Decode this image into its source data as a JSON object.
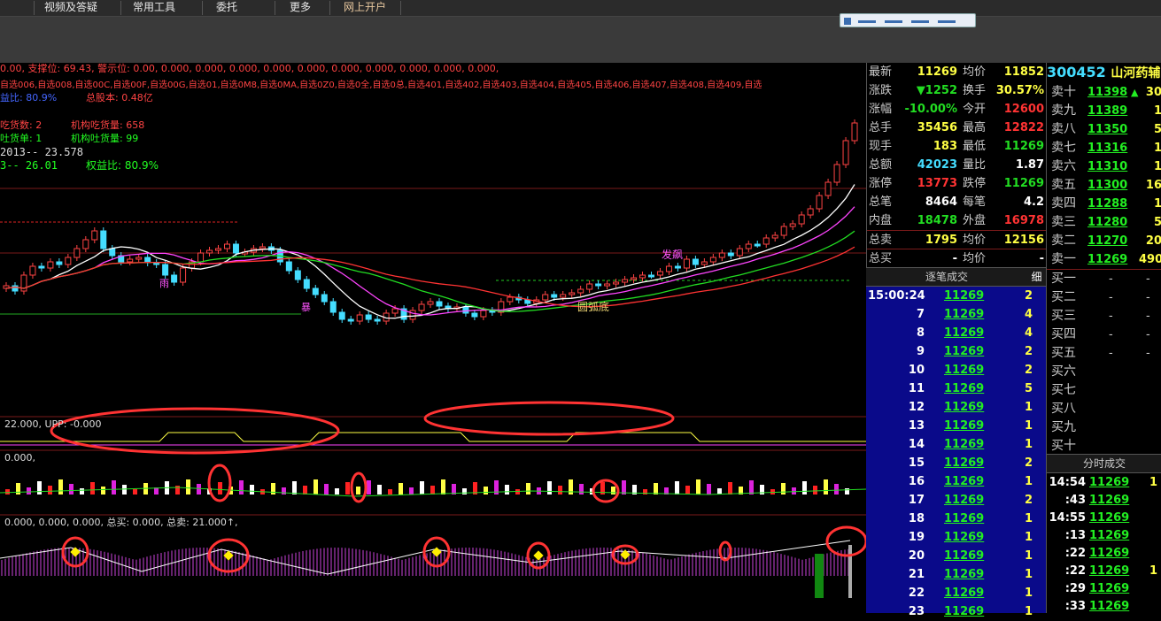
{
  "menu": {
    "items": [
      "视频及答疑",
      "常用工具",
      "委托",
      "更多",
      "网上开户"
    ]
  },
  "main_chart": {
    "indicator_line": "0.00, 支撑位: 69.43, 警示位: 0.00, 0.000, 0.000, 0.000, 0.000, 0.000, 0.000, 0.000, 0.000, 0.000, 0.000,",
    "watchlists": "自选006,自选008,自选00C,自选00F,自选00G,自选01,自选0M8,自选0MA,自选0Z0,自选0全,自选0总,自选401,自选402,自选403,自选404,自选405,自选406,自选407,自选408,自选409,自选",
    "info1": "益比: 80.9%",
    "info2": "总股本: 0.48亿",
    "info3": "吃货数: 2",
    "info4": "机构吃货量: 658",
    "info5": "吐货单: 1",
    "info6": "机构吐货量: 99",
    "info7": "2013-- 23.578",
    "info8": "3-- 26.01",
    "info9": "权益比: 80.9%",
    "label_fa": "发飙",
    "label_arc": "圆弧底",
    "label_rain": "雨",
    "label_bao": "暴"
  },
  "sub1": {
    "label": "22.000, UPP: -0.000"
  },
  "sub2": {
    "label": "0.000,"
  },
  "sub3": {
    "label": "0.000, 0.000, 0.000, 总买: 0.000, 总卖: 21.000↑,"
  },
  "quote": {
    "rows": [
      {
        "l1": "最新",
        "v1": "11269",
        "c1": "#ffff44",
        "l2": "均价",
        "v2": "11852",
        "c2": "#ffff44"
      },
      {
        "l1": "涨跌",
        "v1": "▼1252",
        "c1": "#22dd22",
        "l2": "换手",
        "v2": "30.57%",
        "c2": "#ffff44"
      },
      {
        "l1": "涨幅",
        "v1": "-10.00%",
        "c1": "#22dd22",
        "l2": "今开",
        "v2": "12600",
        "c2": "#ff3333"
      },
      {
        "l1": "总手",
        "v1": "35456",
        "c1": "#ffff44",
        "l2": "最高",
        "v2": "12822",
        "c2": "#ff3333"
      },
      {
        "l1": "现手",
        "v1": "183",
        "c1": "#ffff44",
        "l2": "最低",
        "v2": "11269",
        "c2": "#22dd22"
      },
      {
        "l1": "总额",
        "v1": "42023",
        "c1": "#44ddff",
        "l2": "量比",
        "v2": "1.87",
        "c2": "#ffffff"
      },
      {
        "l1": "涨停",
        "v1": "13773",
        "c1": "#ff3333",
        "l2": "跌停",
        "v2": "11269",
        "c2": "#22dd22"
      },
      {
        "l1": "总笔",
        "v1": "8464",
        "c1": "#ffffff",
        "l2": "每笔",
        "v2": "4.2",
        "c2": "#ffffff"
      },
      {
        "l1": "内盘",
        "v1": "18478",
        "c1": "#22dd22",
        "l2": "外盘",
        "v2": "16978",
        "c2": "#ff3333"
      },
      {
        "l1": "总卖",
        "v1": "1795",
        "c1": "#ffff44",
        "l2": "均价",
        "v2": "12156",
        "c2": "#ffff44"
      },
      {
        "l1": "总买",
        "v1": "-",
        "c1": "#ffffff",
        "l2": "均价",
        "v2": "-",
        "c2": "#ffffff"
      }
    ],
    "tick_header": "逐笔成交",
    "tick_tab": "细",
    "ticks": [
      {
        "t": "15:00:24",
        "p": "11269",
        "v": "2"
      },
      {
        "t": "7",
        "p": "11269",
        "v": "4"
      },
      {
        "t": "8",
        "p": "11269",
        "v": "4"
      },
      {
        "t": "9",
        "p": "11269",
        "v": "2"
      },
      {
        "t": "10",
        "p": "11269",
        "v": "2"
      },
      {
        "t": "11",
        "p": "11269",
        "v": "5"
      },
      {
        "t": "12",
        "p": "11269",
        "v": "1"
      },
      {
        "t": "13",
        "p": "11269",
        "v": "1"
      },
      {
        "t": "14",
        "p": "11269",
        "v": "1"
      },
      {
        "t": "15",
        "p": "11269",
        "v": "2"
      },
      {
        "t": "16",
        "p": "11269",
        "v": "1"
      },
      {
        "t": "17",
        "p": "11269",
        "v": "2"
      },
      {
        "t": "18",
        "p": "11269",
        "v": "1"
      },
      {
        "t": "19",
        "p": "11269",
        "v": "1"
      },
      {
        "t": "20",
        "p": "11269",
        "v": "1"
      },
      {
        "t": "21",
        "p": "11269",
        "v": "1"
      },
      {
        "t": "22",
        "p": "11269",
        "v": "1"
      },
      {
        "t": "23",
        "p": "11269",
        "v": "1"
      }
    ]
  },
  "orderbook": {
    "code": "300452",
    "name": "山河药辅",
    "asks": [
      {
        "l": "卖十",
        "p": "11398",
        "v": "30",
        "arrow": "▲"
      },
      {
        "l": "卖九",
        "p": "11389",
        "v": "1",
        "arrow": ""
      },
      {
        "l": "卖八",
        "p": "11350",
        "v": "5",
        "arrow": ""
      },
      {
        "l": "卖七",
        "p": "11316",
        "v": "1",
        "arrow": ""
      },
      {
        "l": "卖六",
        "p": "11310",
        "v": "1",
        "arrow": ""
      },
      {
        "l": "卖五",
        "p": "11300",
        "v": "16",
        "arrow": ""
      },
      {
        "l": "卖四",
        "p": "11288",
        "v": "1",
        "arrow": ""
      },
      {
        "l": "卖三",
        "p": "11280",
        "v": "5",
        "arrow": ""
      },
      {
        "l": "卖二",
        "p": "11270",
        "v": "20",
        "arrow": ""
      },
      {
        "l": "卖一",
        "p": "11269",
        "v": "490",
        "arrow": ""
      }
    ],
    "bids": [
      {
        "l": "买一",
        "p": "-",
        "v": "-"
      },
      {
        "l": "买二",
        "p": "-",
        "v": "-"
      },
      {
        "l": "买三",
        "p": "-",
        "v": "-"
      },
      {
        "l": "买四",
        "p": "-",
        "v": "-"
      },
      {
        "l": "买五",
        "p": "-",
        "v": "-"
      },
      {
        "l": "买六",
        "p": "",
        "v": ""
      },
      {
        "l": "买七",
        "p": "",
        "v": ""
      },
      {
        "l": "买八",
        "p": "",
        "v": ""
      },
      {
        "l": "买九",
        "p": "",
        "v": ""
      },
      {
        "l": "买十",
        "p": "",
        "v": ""
      }
    ],
    "time_header": "分时成交",
    "time_ticks": [
      {
        "t": "14:54",
        "p": "11269",
        "v": "1"
      },
      {
        "t": ":43",
        "p": "11269",
        "v": ""
      },
      {
        "t": "14:55",
        "p": "11269",
        "v": ""
      },
      {
        "t": ":13",
        "p": "11269",
        "v": ""
      },
      {
        "t": ":22",
        "p": "11269",
        "v": ""
      },
      {
        "t": ":22",
        "p": "11269",
        "v": "1"
      },
      {
        "t": ":29",
        "p": "11269",
        "v": ""
      },
      {
        "t": ":33",
        "p": "11269",
        "v": ""
      }
    ]
  }
}
